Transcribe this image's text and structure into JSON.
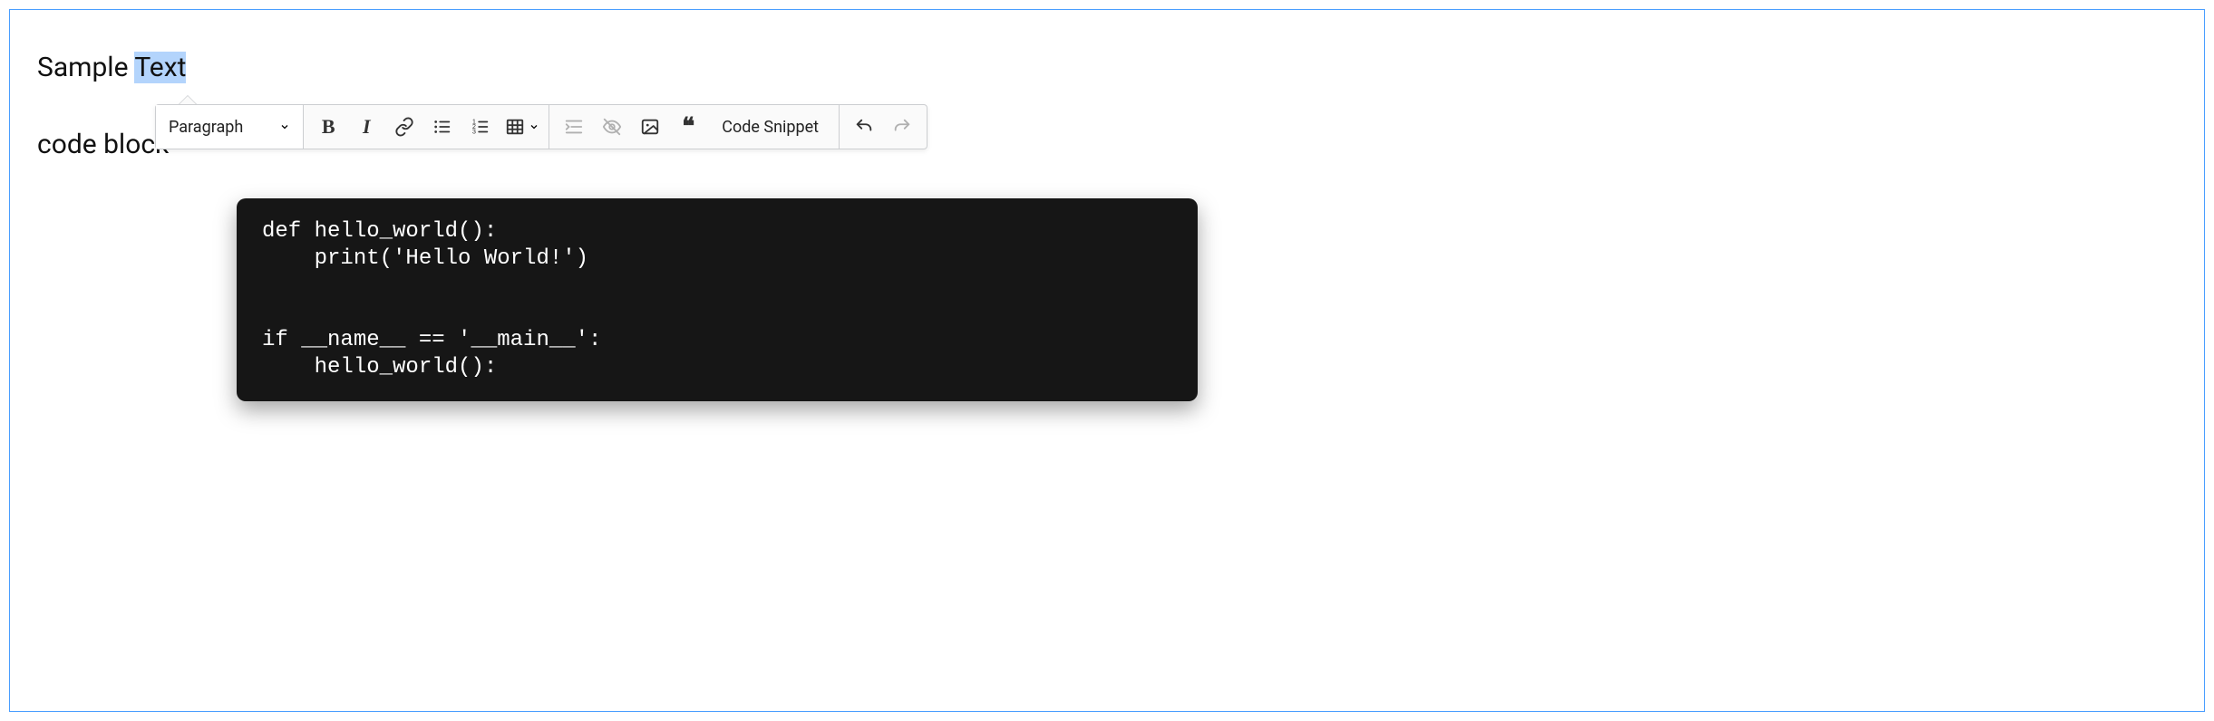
{
  "content": {
    "line1_pre": "Sample ",
    "line1_highlight": "Text",
    "line2": "code block",
    "code": "def hello_world():\n    print('Hello World!')\n\n\nif __name__ == '__main__':\n    hello_world():"
  },
  "toolbar": {
    "heading_label": "Paragraph",
    "code_snippet_label": "Code Snippet"
  }
}
